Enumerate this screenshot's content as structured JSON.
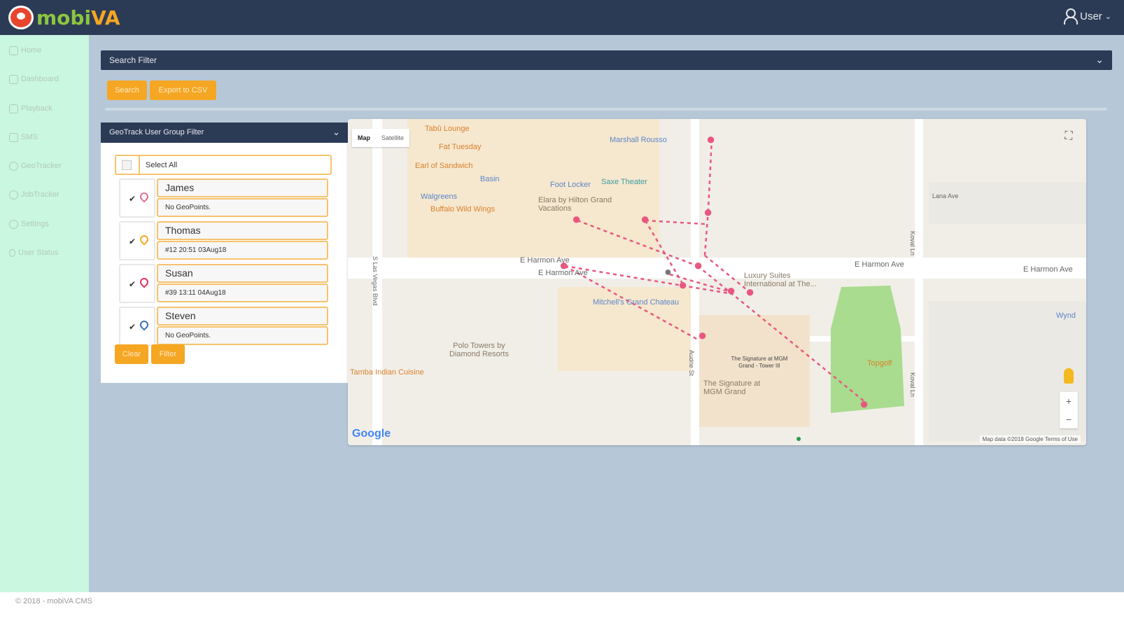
{
  "header": {
    "logo_text_a": "mobi",
    "logo_text_b": "VA",
    "user_label": "User"
  },
  "sidebar": {
    "items": [
      {
        "label": "Home",
        "icon": "home-icon"
      },
      {
        "label": "Dashboard",
        "icon": "dashboard-icon"
      },
      {
        "label": "Playback",
        "icon": "playback-icon"
      },
      {
        "label": "SMS",
        "icon": "sms-icon"
      },
      {
        "label": "GeoTracker",
        "icon": "location-icon"
      },
      {
        "label": "JobTracker",
        "icon": "jobtracker-icon"
      },
      {
        "label": "Settings",
        "icon": "gear-icon"
      },
      {
        "label": "User Status",
        "icon": "pin-icon"
      }
    ]
  },
  "search_filter": {
    "title": "Search Filter",
    "search_label": "Search",
    "export_label": "Export to CSV"
  },
  "group_filter": {
    "title": "GeoTrack User Group Filter",
    "select_all_label": "Select All",
    "users": [
      {
        "name": "James",
        "status": "No GeoPoints.",
        "checked": true,
        "pin_color": "#e26d8f"
      },
      {
        "name": "Thomas",
        "status": "#12 20:51 03Aug18",
        "checked": true,
        "pin_color": "#f5a623"
      },
      {
        "name": "Susan",
        "status": "#39 13:11 04Aug18",
        "checked": true,
        "pin_color": "#e0335a"
      },
      {
        "name": "Steven",
        "status": "No GeoPoints.",
        "checked": true,
        "pin_color": "#3b6fb6"
      }
    ],
    "clear_label": "Clear",
    "filter_label": "Filter"
  },
  "map": {
    "type_map": "Map",
    "type_satellite": "Satellite",
    "labels": {
      "tabu": "Tabû Lounge",
      "fat_tuesday": "Fat Tuesday",
      "earl": "Earl of Sandwich",
      "marshall": "Marshall Rousso",
      "basin": "Basin",
      "foot_locker": "Foot Locker",
      "saxe": "Saxe Theater",
      "walgreens": "Walgreens",
      "buffalo": "Buffalo Wild Wings",
      "elara": "Elara by Hilton Grand Vacations",
      "harmon_1": "E Harmon Ave",
      "harmon_2": "E Harmon Ave",
      "harmon_3": "E Harmon Ave",
      "harmon_4": "E Harmon Ave",
      "luxury": "Luxury Suites International at The...",
      "mitchells": "Mitchell's Grand Chateau",
      "polo": "Polo Towers by Diamond Resorts",
      "tamba": "Tamba Indian Cuisine",
      "signature_tower": "The Signature at MGM Grand - Tower III",
      "signature": "The Signature at MGM Grand",
      "topgolf": "Topgolf",
      "lana": "Lana Ave",
      "koval": "Koval Ln",
      "koval_2": "Koval Ln",
      "las_vegas": "S Las Vegas Blvd",
      "audrie": "Audrie St",
      "wyndham": "Wynd",
      "google": "Google",
      "attribution": "Map data ©2018 Google   Terms of Use"
    },
    "colors": {
      "track": "#e8587e",
      "pin_pink": "#e8587e",
      "pin_blue": "#6c8fd6",
      "pin_orange": "#f39c4a",
      "park": "#a9dc8f"
    }
  },
  "footer": {
    "text": "© 2018 - mobiVA CMS"
  }
}
